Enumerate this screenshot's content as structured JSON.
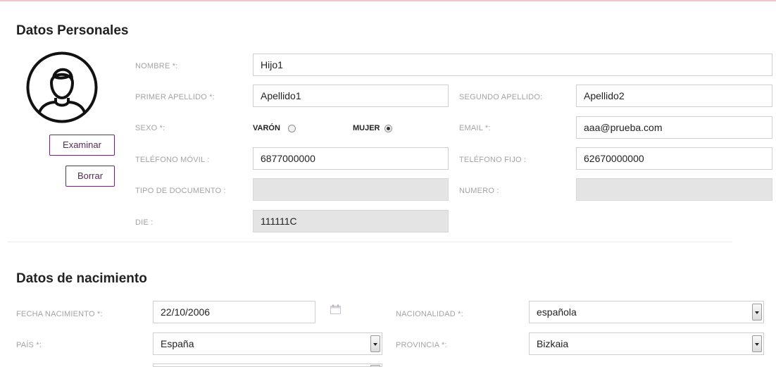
{
  "personal": {
    "title": "Datos Personales",
    "examinar_label": "Examinar",
    "borrar_label": "Borrar",
    "nombre": {
      "label": "NOMBRE *:",
      "value": "Hijo1"
    },
    "primer_apellido": {
      "label": "PRIMER APELLIDO *:",
      "value": "Apellido1"
    },
    "segundo_apellido": {
      "label": "SEGUNDO APELLIDO:",
      "value": "Apellido2"
    },
    "sexo": {
      "label": "SEXO *:",
      "options": [
        {
          "label": "VARÓN",
          "checked": false
        },
        {
          "label": "MUJER",
          "checked": true
        }
      ]
    },
    "email": {
      "label": "EMAIL *:",
      "value": "aaa@prueba.com"
    },
    "telefono_movil": {
      "label": "TELÉFONO MÓVIL :",
      "value": "6877000000"
    },
    "telefono_fijo": {
      "label": "TELÉFONO FIJO :",
      "value": "62670000000"
    },
    "tipo_documento": {
      "label": "TIPO DE DOCUMENTO :",
      "value": ""
    },
    "numero": {
      "label": "NUMERO :",
      "value": ""
    },
    "die": {
      "label": "DIE :",
      "value": "111111C"
    }
  },
  "birth": {
    "title": "Datos de nacimiento",
    "fecha_nacimiento": {
      "label": "FECHA NACIMIENTO *:",
      "value": "22/10/2006"
    },
    "nacionalidad": {
      "label": "NACIONALIDAD *:",
      "value": "española"
    },
    "pais": {
      "label": "PAÍS *:",
      "value": "España"
    },
    "provincia": {
      "label": "PROVINCIA *:",
      "value": "Bizkaia"
    }
  },
  "colors": {
    "button_border": "#6b2a6b",
    "disabled_field": "#e4e4e4",
    "label_gray": "#a3a3a3"
  },
  "icons": [
    "user-avatar-icon",
    "calendar-icon",
    "chevron-down-icon"
  ]
}
